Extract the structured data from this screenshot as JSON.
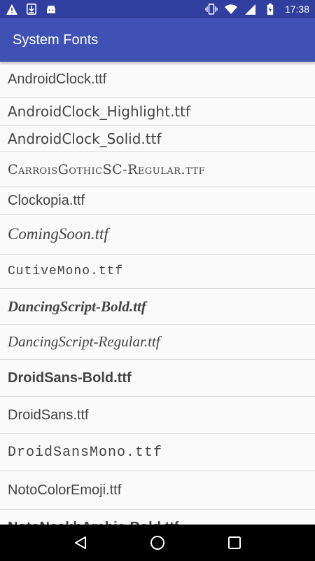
{
  "status_bar": {
    "time": "17:38",
    "left_icons": [
      "warning-icon",
      "download-icon",
      "android-icon"
    ],
    "right_icons": [
      "vibrate-icon",
      "wifi-icon",
      "signal-icon",
      "battery-icon"
    ],
    "color": "#303f9f"
  },
  "app_bar": {
    "title": "System Fonts",
    "color": "#3f51b5"
  },
  "fonts": [
    "AndroidClock.ttf",
    "AndroidClock_Highlight.ttf",
    "AndroidClock_Solid.ttf",
    "CarroisGothicSC-Regular.ttf",
    "Clockopia.ttf",
    "ComingSoon.ttf",
    "CutiveMono.ttf",
    "DancingScript-Bold.ttf",
    "DancingScript-Regular.ttf",
    "DroidSans-Bold.ttf",
    "DroidSans.ttf",
    "DroidSansMono.ttf",
    "NotoColorEmoji.ttf",
    "NotoNaskhArabic-Bold.ttf"
  ],
  "nav_bar": {
    "buttons": [
      "back-icon",
      "home-icon",
      "recents-icon"
    ]
  }
}
